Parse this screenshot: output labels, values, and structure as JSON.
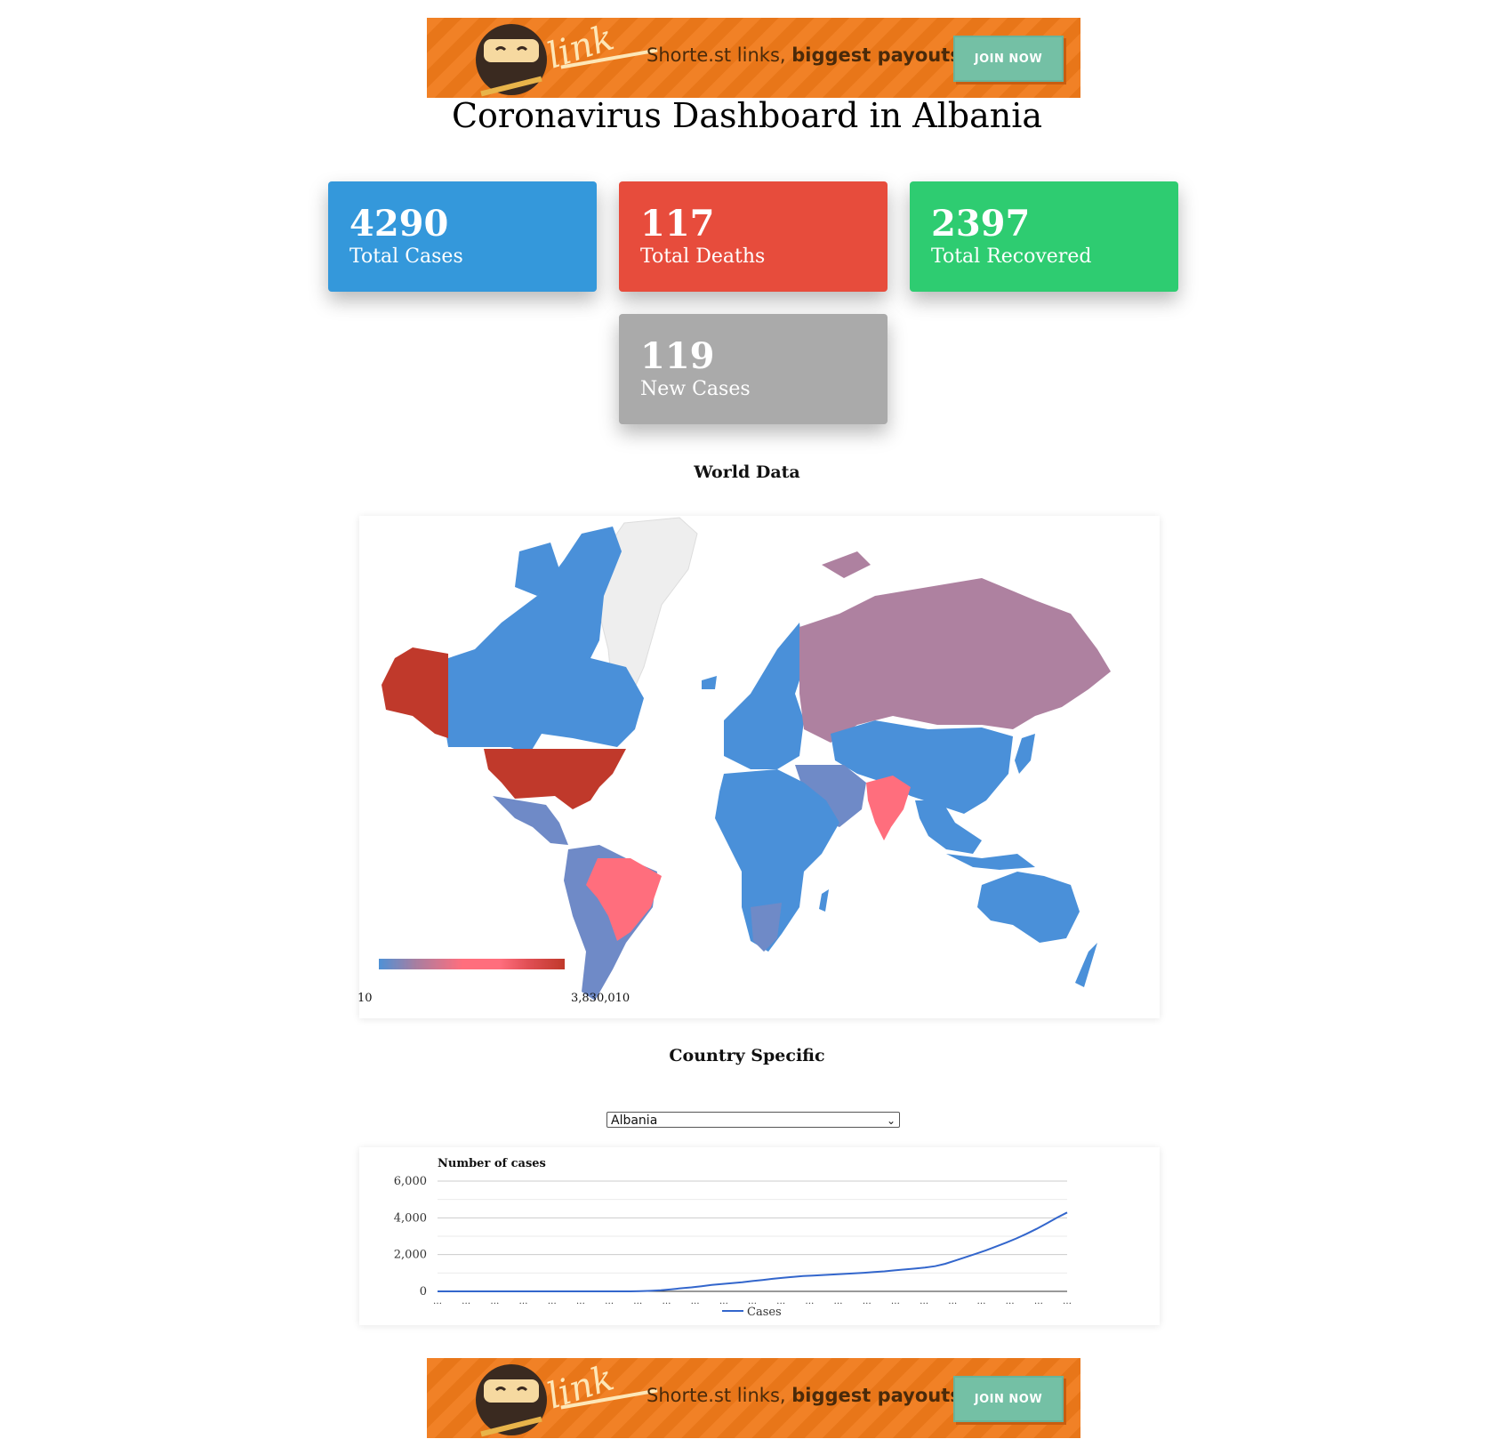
{
  "ad": {
    "logo_text": "link",
    "tagline_plain": "Shorte.st links, ",
    "tagline_bold": "biggest payouts.",
    "join_label": "JOIN NOW",
    "bg_color": "#f07a1a"
  },
  "title": "Coronavirus Dashboard in Albania",
  "stats": [
    {
      "value": "4290",
      "label": "Total Cases",
      "color": "#3498db"
    },
    {
      "value": "117",
      "label": "Total Deaths",
      "color": "#e74c3c"
    },
    {
      "value": "2397",
      "label": "Total Recovered",
      "color": "#2ecc71"
    },
    {
      "value": "119",
      "label": "New Cases",
      "color": "#aaaaaa"
    }
  ],
  "world": {
    "title": "World Data",
    "legend_min": "10",
    "legend_max": "3,830,010"
  },
  "country": {
    "title": "Country Specific",
    "selected": "Albania"
  },
  "chart_data": {
    "type": "line",
    "title": "Number of cases",
    "xlabel": "",
    "ylabel": "",
    "ylim": [
      0,
      6000
    ],
    "yticks": [
      "0",
      "2,000",
      "4,000",
      "6,000"
    ],
    "x_tick_labels": [
      "…",
      "…",
      "…",
      "…",
      "…",
      "…",
      "…",
      "…",
      "…",
      "…",
      "…",
      "…",
      "…",
      "…",
      "…",
      "…",
      "…",
      "…",
      "…",
      "…",
      "…",
      "…",
      "…"
    ],
    "series": [
      {
        "name": "Cases",
        "color": "#3366cc",
        "values": [
          0,
          0,
          0,
          0,
          0,
          0,
          0,
          0,
          0,
          0,
          0,
          0,
          0,
          0,
          0,
          0,
          0,
          0,
          0,
          0,
          10,
          30,
          60,
          110,
          170,
          220,
          280,
          350,
          400,
          450,
          500,
          560,
          620,
          680,
          740,
          790,
          830,
          860,
          890,
          920,
          950,
          980,
          1010,
          1050,
          1090,
          1140,
          1190,
          1240,
          1290,
          1370,
          1500,
          1680,
          1860,
          2040,
          2230,
          2440,
          2650,
          2880,
          3130,
          3400,
          3700,
          4010,
          4290
        ]
      }
    ],
    "legend_position": "bottom"
  }
}
